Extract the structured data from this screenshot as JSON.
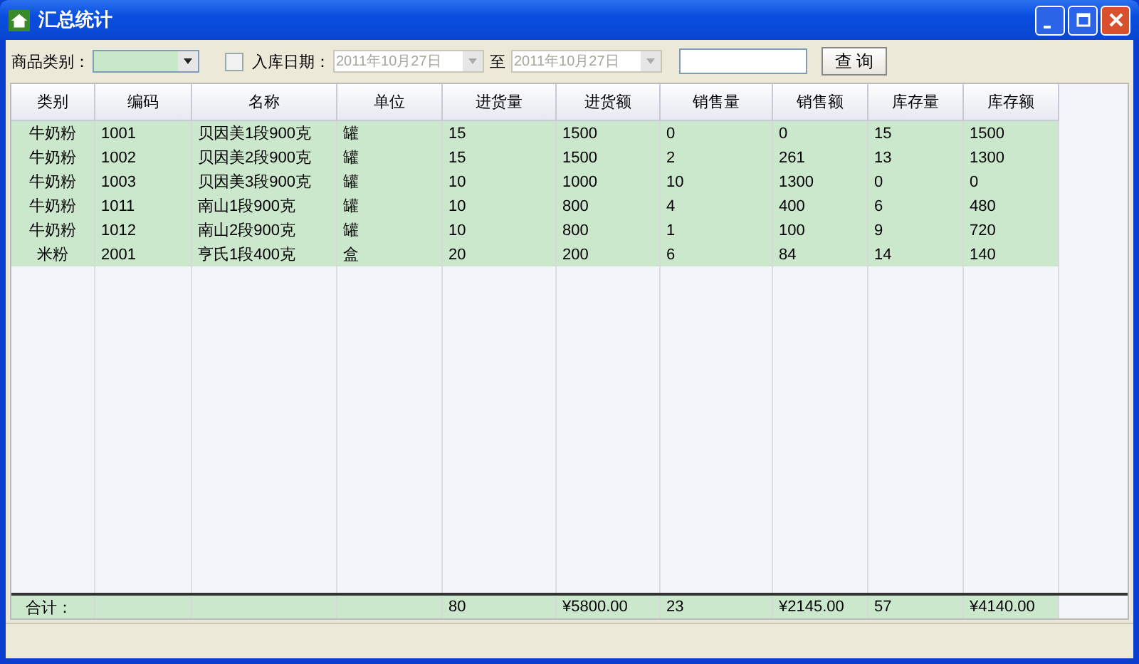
{
  "window": {
    "title": "汇总统计"
  },
  "filters": {
    "category_label": "商品类别：",
    "date_checkbox": {
      "label": "入库日期：",
      "checked": false
    },
    "date_from": {
      "value": "2011年10月27日",
      "disabled": true
    },
    "to_label": "至",
    "date_to": {
      "value": "2011年10月27日",
      "disabled": true
    },
    "search_button": "查 询"
  },
  "table": {
    "columns": [
      "类别",
      "编码",
      "名称",
      "单位",
      "进货量",
      "进货额",
      "销售量",
      "销售额",
      "库存量",
      "库存额"
    ],
    "rows": [
      [
        "牛奶粉",
        "1001",
        "贝因美1段900克",
        "罐",
        "15",
        "1500",
        "0",
        "0",
        "15",
        "1500"
      ],
      [
        "牛奶粉",
        "1002",
        "贝因美2段900克",
        "罐",
        "15",
        "1500",
        "2",
        "261",
        "13",
        "1300"
      ],
      [
        "牛奶粉",
        "1003",
        "贝因美3段900克",
        "罐",
        "10",
        "1000",
        "10",
        "1300",
        "0",
        "0"
      ],
      [
        "牛奶粉",
        "1011",
        "南山1段900克",
        "罐",
        "10",
        "800",
        "4",
        "400",
        "6",
        "480"
      ],
      [
        "牛奶粉",
        "1012",
        "南山2段900克",
        "罐",
        "10",
        "800",
        "1",
        "100",
        "9",
        "720"
      ],
      [
        "米粉",
        "2001",
        "亨氏1段400克",
        "盒",
        "20",
        "200",
        "6",
        "84",
        "14",
        "140"
      ]
    ],
    "totals": {
      "label": "合计：",
      "values": [
        "80",
        "¥5800.00",
        "23",
        "¥2145.00",
        "57",
        "¥4140.00"
      ]
    }
  }
}
